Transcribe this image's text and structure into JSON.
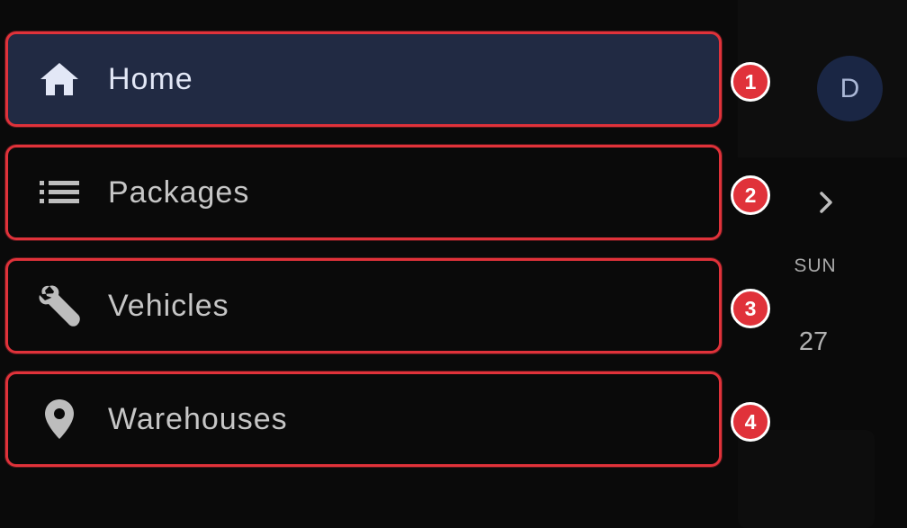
{
  "drawer": {
    "items": [
      {
        "label": "Home",
        "icon": "home-icon",
        "active": true,
        "marker": "1"
      },
      {
        "label": "Packages",
        "icon": "list-icon",
        "active": false,
        "marker": "2"
      },
      {
        "label": "Vehicles",
        "icon": "wrench-icon",
        "active": false,
        "marker": "3"
      },
      {
        "label": "Warehouses",
        "icon": "location-pin-icon",
        "active": false,
        "marker": "4"
      }
    ]
  },
  "background": {
    "avatar_initial": "D",
    "day_name": "SUN",
    "day_number": "27",
    "next_icon": "chevron-right-icon"
  },
  "colors": {
    "active_item_bg": "#212a43",
    "highlight_border": "#e0323a",
    "marker_bg": "#e0323a"
  }
}
